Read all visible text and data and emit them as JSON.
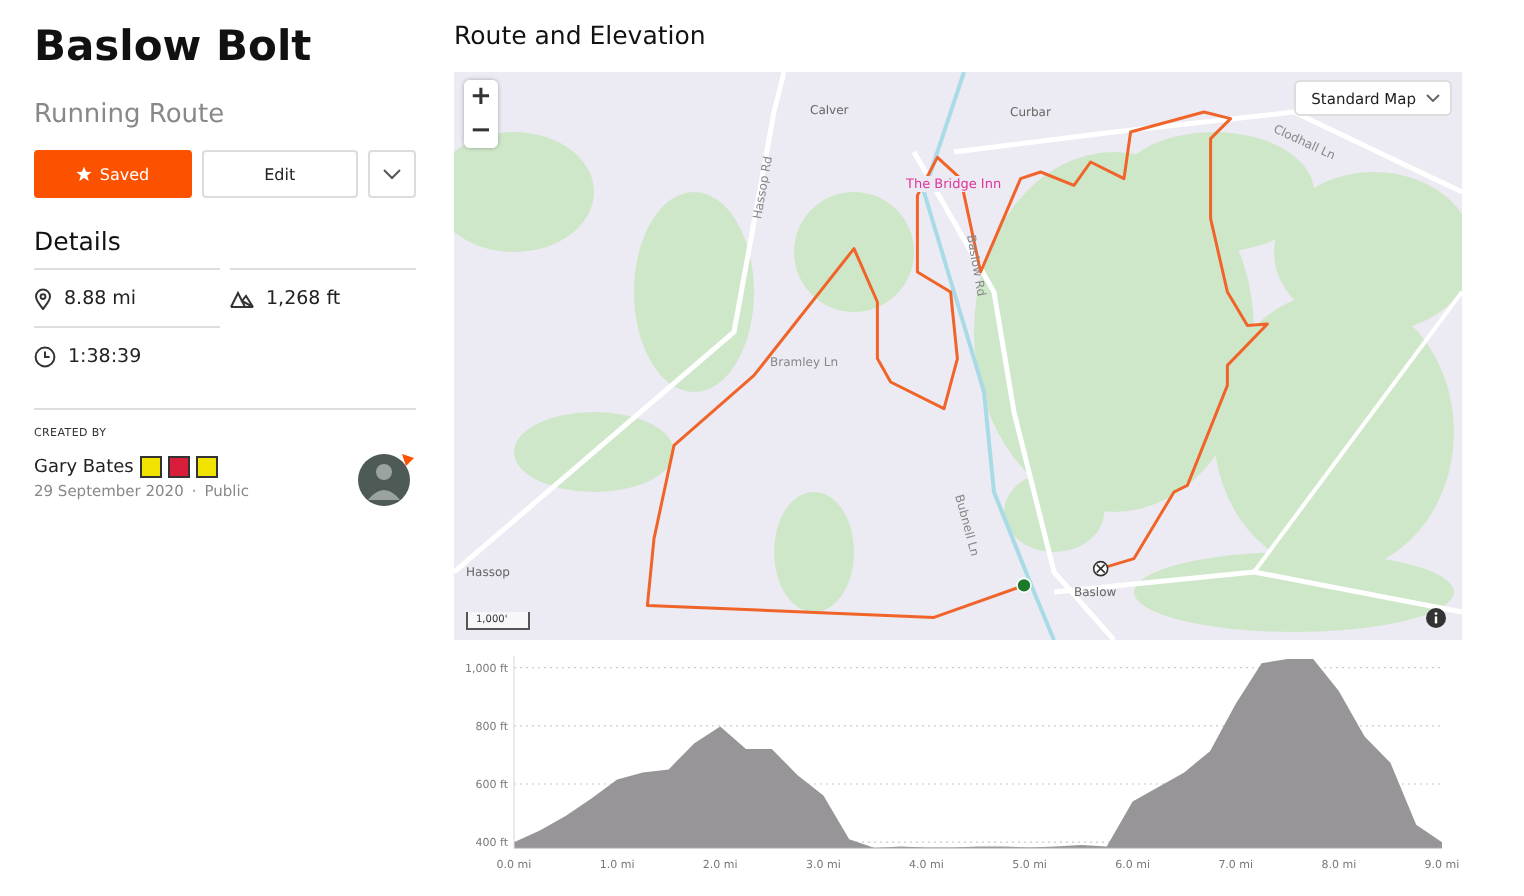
{
  "route": {
    "title": "Baslow Bolt",
    "type": "Running Route"
  },
  "actions": {
    "saved": {
      "label": "Saved",
      "selected": true
    },
    "edit": "Edit"
  },
  "details": {
    "heading": "Details",
    "stats": [
      {
        "kind": "distance",
        "value": "8.88 mi"
      },
      {
        "kind": "elevation",
        "value": "1,268 ft"
      },
      {
        "kind": "time",
        "value": "1:38:39"
      }
    ]
  },
  "creator": {
    "label": "CREATED BY",
    "name": "Gary Bates",
    "badges": [
      {
        "color": "#f2e200"
      },
      {
        "color": "#d81e3a"
      },
      {
        "color": "#f2e200"
      }
    ],
    "date": "29 September 2020",
    "separator": "·",
    "visibility": "Public"
  },
  "map_section": {
    "heading": "Route and Elevation",
    "zoom_controls": [
      "+",
      "−"
    ],
    "map_type": "Standard Map",
    "scale": "1,000'",
    "labels": [
      {
        "kind": "place",
        "text": "Calver"
      },
      {
        "kind": "place",
        "text": "Curbar"
      },
      {
        "kind": "poi",
        "text": "The Bridge Inn"
      },
      {
        "kind": "road",
        "text": "Hassop Rd"
      },
      {
        "kind": "road",
        "text": "Baslow Rd"
      },
      {
        "kind": "road",
        "text": "Clodhall Ln"
      },
      {
        "kind": "road",
        "text": "Bramley Ln"
      },
      {
        "kind": "road",
        "text": "Bubnell Ln"
      },
      {
        "kind": "place",
        "text": "Hassop"
      },
      {
        "kind": "place",
        "text": "Baslow"
      }
    ]
  },
  "elevation": {
    "chart_data": {
      "type": "area",
      "x": [
        0,
        0.25,
        0.5,
        0.75,
        1,
        1.25,
        1.5,
        1.75,
        2,
        2.25,
        2.5,
        2.75,
        3,
        3.25,
        3.5,
        3.75,
        4,
        4.25,
        4.5,
        4.75,
        5,
        5.25,
        5.5,
        5.75,
        6,
        6.25,
        6.5,
        6.75,
        7,
        7.25,
        7.5,
        7.75,
        8,
        8.25,
        8.5,
        8.75,
        9
      ],
      "series": [
        {
          "color": "#979598",
          "values": [
            400,
            440,
            490,
            550,
            615,
            640,
            650,
            740,
            797,
            720,
            720,
            630,
            560,
            410,
            380,
            385,
            382,
            382,
            385,
            385,
            382,
            385,
            390,
            385,
            540,
            590,
            640,
            713,
            876,
            1015,
            1030,
            1030,
            920,
            763,
            673,
            460,
            400
          ]
        }
      ],
      "xlim": [
        0,
        9
      ],
      "ylim": [
        380,
        1040
      ],
      "grid": true,
      "xticks": [
        {
          "value": 0,
          "label": "0.0 mi"
        },
        {
          "value": 1,
          "label": "1.0 mi"
        },
        {
          "value": 2,
          "label": "2.0 mi"
        },
        {
          "value": 3,
          "label": "3.0 mi"
        },
        {
          "value": 4,
          "label": "4.0 mi"
        },
        {
          "value": 5,
          "label": "5.0 mi"
        },
        {
          "value": 6,
          "label": "6.0 mi"
        },
        {
          "value": 7,
          "label": "7.0 mi"
        },
        {
          "value": 8,
          "label": "8.0 mi"
        },
        {
          "value": 9,
          "label": "9.0 mi"
        }
      ],
      "yticks": [
        {
          "value": 400,
          "label": "400 ft"
        },
        {
          "value": 600,
          "label": "600 ft"
        },
        {
          "value": 800,
          "label": "800 ft"
        },
        {
          "value": 1000,
          "label": "1,000 ft"
        }
      ]
    }
  }
}
